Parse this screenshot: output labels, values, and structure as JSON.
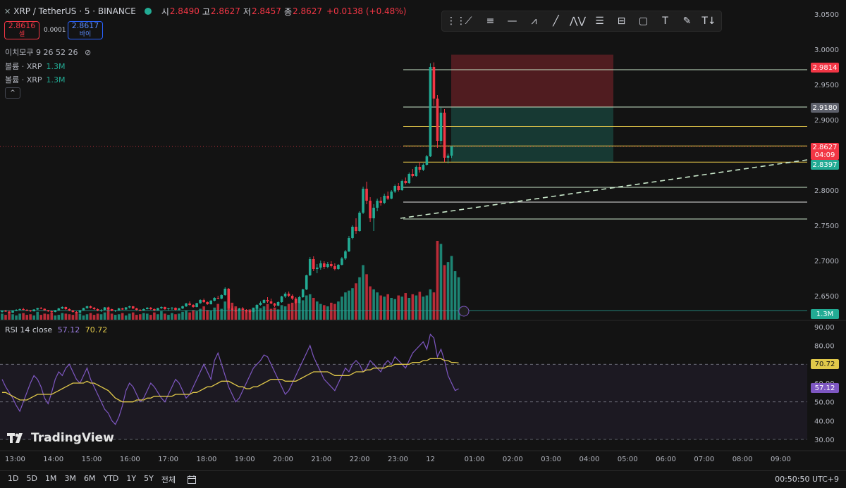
{
  "header": {
    "symbol": "XRP / TetherUS · 5 · BINANCE",
    "open_label": "시",
    "open": "2.8490",
    "high_label": "고",
    "high": "2.8627",
    "low_label": "저",
    "low": "2.8457",
    "close_label": "종",
    "close": "2.8627",
    "change": "+0.0138 (+0.48%)"
  },
  "quote": {
    "sell_price": "2.8616",
    "sell_label": "셀",
    "spread": "0.0001",
    "buy_price": "2.8617",
    "buy_label": "바이"
  },
  "indicators": {
    "moving_avg": "이치모쿠 9 26 52 26",
    "volume_1_label": "볼륨 · XRP",
    "volume_1_value": "1.3M",
    "volume_2_label": "볼륨 · XRP",
    "volume_2_value": "1.3M",
    "collapse": "^"
  },
  "rsi": {
    "label": "RSI 14 close",
    "value": "57.12",
    "ma": "70.72"
  },
  "logo": "TradingView",
  "colors": {
    "up": "#22ab94",
    "down": "#f23645",
    "rsi": "#7e57c2",
    "rsi_ma": "#e0c84a",
    "bg": "#131313"
  },
  "toolbar_icons": [
    "grip-icon",
    "trend-icon",
    "fib-icon",
    "horizontal-line-icon",
    "pattern-icon",
    "line-icon",
    "abcd-icon",
    "parallel-icon",
    "channel-icon",
    "rectangle-icon",
    "text-icon",
    "brush-icon",
    "text-note-icon"
  ],
  "price_axis": {
    "ticks": [
      "3.0500",
      "3.0000",
      "2.9500",
      "2.9000",
      "2.8500",
      "2.8000",
      "2.7500",
      "2.7000",
      "2.6500"
    ],
    "labels": [
      {
        "text": "2.9814",
        "color": "#f23645"
      },
      {
        "text": "2.9180",
        "color": "#5d606b"
      },
      {
        "text": "2.8627",
        "sub": "04:09",
        "color": "#f23645"
      },
      {
        "text": "2.8397",
        "color": "#22ab94"
      },
      {
        "text": "1.3M",
        "color": "#22ab94"
      }
    ]
  },
  "rsi_axis": {
    "ticks": [
      "90.00",
      "80.00",
      "60.00",
      "50.00",
      "40.00",
      "30.00"
    ],
    "labels": [
      {
        "text": "70.72",
        "color": "#e0c84a"
      },
      {
        "text": "57.12",
        "color": "#7e57c2"
      }
    ]
  },
  "time_axis": [
    "13:00",
    "14:00",
    "15:00",
    "16:00",
    "17:00",
    "18:00",
    "19:00",
    "20:00",
    "21:00",
    "22:00",
    "23:00",
    "12",
    "01:00",
    "02:00",
    "03:00",
    "04:00",
    "05:00",
    "06:00",
    "07:00",
    "08:00",
    "09:00"
  ],
  "bottom_bar": {
    "ranges": [
      "1D",
      "5D",
      "1M",
      "3M",
      "6M",
      "YTD",
      "1Y",
      "5Y",
      "전체"
    ],
    "clock": "00:50:50 UTC+9"
  },
  "chart_data": {
    "type": "candlestick",
    "ylim": [
      2.62,
      3.07
    ],
    "drawn_levels": [
      2.9814,
      2.918,
      2.8905,
      2.8627,
      2.8397,
      2.804,
      2.783,
      2.759
    ],
    "position": {
      "stop": 2.9814,
      "entry": 2.918,
      "target": 2.8397
    },
    "candles": [
      [
        2.627,
        2.629,
        2.626,
        2.6285
      ],
      [
        2.6285,
        2.63,
        2.627,
        2.6275
      ],
      [
        2.6275,
        2.629,
        2.625,
        2.626
      ],
      [
        2.626,
        2.6295,
        2.6255,
        2.629
      ],
      [
        2.629,
        2.631,
        2.628,
        2.63
      ],
      [
        2.63,
        2.632,
        2.629,
        2.631
      ],
      [
        2.631,
        2.633,
        2.6295,
        2.63
      ],
      [
        2.63,
        2.631,
        2.628,
        2.629
      ],
      [
        2.629,
        2.63,
        2.627,
        2.628
      ],
      [
        2.628,
        2.631,
        2.6275,
        2.6305
      ],
      [
        2.6305,
        2.633,
        2.63,
        2.6325
      ],
      [
        2.6325,
        2.634,
        2.631,
        2.6315
      ],
      [
        2.6315,
        2.632,
        2.629,
        2.6295
      ],
      [
        2.6295,
        2.63,
        2.627,
        2.628
      ],
      [
        2.628,
        2.629,
        2.626,
        2.627
      ],
      [
        2.627,
        2.63,
        2.6265,
        2.6295
      ],
      [
        2.6295,
        2.633,
        2.629,
        2.632
      ],
      [
        2.632,
        2.635,
        2.631,
        2.634
      ],
      [
        2.634,
        2.6345,
        2.63,
        2.631
      ],
      [
        2.631,
        2.632,
        2.628,
        2.629
      ],
      [
        2.629,
        2.63,
        2.626,
        2.627
      ],
      [
        2.627,
        2.628,
        2.625,
        2.626
      ],
      [
        2.626,
        2.63,
        2.6255,
        2.6295
      ],
      [
        2.6295,
        2.633,
        2.629,
        2.6325
      ],
      [
        2.6325,
        2.636,
        2.6315,
        2.635
      ],
      [
        2.635,
        2.636,
        2.632,
        2.633
      ],
      [
        2.633,
        2.634,
        2.63,
        2.631
      ],
      [
        2.631,
        2.632,
        2.628,
        2.629
      ],
      [
        2.629,
        2.631,
        2.627,
        2.63
      ],
      [
        2.63,
        2.634,
        2.6295,
        2.6335
      ],
      [
        2.6335,
        2.6345,
        2.63,
        2.631
      ],
      [
        2.631,
        2.6315,
        2.628,
        2.6285
      ],
      [
        2.6285,
        2.63,
        2.627,
        2.6295
      ],
      [
        2.6295,
        2.633,
        2.629,
        2.632
      ],
      [
        2.632,
        2.633,
        2.63,
        2.6305
      ],
      [
        2.6305,
        2.634,
        2.63,
        2.6335
      ],
      [
        2.6335,
        2.636,
        2.632,
        2.635
      ],
      [
        2.635,
        2.6355,
        2.631,
        2.632
      ],
      [
        2.632,
        2.633,
        2.629,
        2.63
      ],
      [
        2.63,
        2.631,
        2.628,
        2.629
      ],
      [
        2.629,
        2.632,
        2.6285,
        2.631
      ],
      [
        2.631,
        2.634,
        2.6305,
        2.633
      ],
      [
        2.633,
        2.634,
        2.63,
        2.631
      ],
      [
        2.631,
        2.632,
        2.628,
        2.6295
      ],
      [
        2.6295,
        2.633,
        2.629,
        2.6325
      ],
      [
        2.6325,
        2.635,
        2.631,
        2.634
      ],
      [
        2.634,
        2.6345,
        2.63,
        2.631
      ],
      [
        2.631,
        2.633,
        2.629,
        2.632
      ],
      [
        2.632,
        2.634,
        2.63,
        2.633
      ],
      [
        2.633,
        2.6335,
        2.629,
        2.63
      ],
      [
        2.63,
        2.633,
        2.629,
        2.632
      ],
      [
        2.632,
        2.636,
        2.631,
        2.635
      ],
      [
        2.635,
        2.64,
        2.634,
        2.639
      ],
      [
        2.639,
        2.642,
        2.636,
        2.637
      ],
      [
        2.637,
        2.638,
        2.633,
        2.634
      ],
      [
        2.634,
        2.64,
        2.6335,
        2.6395
      ],
      [
        2.6395,
        2.645,
        2.6385,
        2.644
      ],
      [
        2.644,
        2.646,
        2.64,
        2.641
      ],
      [
        2.641,
        2.642,
        2.637,
        2.638
      ],
      [
        2.638,
        2.644,
        2.6375,
        2.643
      ],
      [
        2.643,
        2.648,
        2.642,
        2.647
      ],
      [
        2.647,
        2.65,
        2.645,
        2.646
      ],
      [
        2.646,
        2.652,
        2.645,
        2.651
      ],
      [
        2.651,
        2.662,
        2.65,
        2.66
      ],
      [
        2.66,
        2.661,
        2.63,
        2.632
      ],
      [
        2.632,
        2.635,
        2.628,
        2.63
      ],
      [
        2.63,
        2.632,
        2.627,
        2.629
      ],
      [
        2.629,
        2.633,
        2.6285,
        2.632
      ],
      [
        2.632,
        2.634,
        2.629,
        2.63
      ],
      [
        2.63,
        2.631,
        2.626,
        2.628
      ],
      [
        2.628,
        2.63,
        2.625,
        2.627
      ],
      [
        2.627,
        2.633,
        2.6265,
        2.632
      ],
      [
        2.632,
        2.638,
        2.631,
        2.637
      ],
      [
        2.637,
        2.642,
        2.636,
        2.64
      ],
      [
        2.64,
        2.645,
        2.639,
        2.644
      ],
      [
        2.644,
        2.648,
        2.64,
        2.642
      ],
      [
        2.642,
        2.646,
        2.638,
        2.639
      ],
      [
        2.639,
        2.64,
        2.634,
        2.636
      ],
      [
        2.636,
        2.642,
        2.635,
        2.641
      ],
      [
        2.641,
        2.65,
        2.64,
        2.649
      ],
      [
        2.649,
        2.655,
        2.647,
        2.653
      ],
      [
        2.653,
        2.656,
        2.648,
        2.65
      ],
      [
        2.65,
        2.652,
        2.644,
        2.646
      ],
      [
        2.646,
        2.648,
        2.638,
        2.64
      ],
      [
        2.64,
        2.65,
        2.639,
        2.648
      ],
      [
        2.648,
        2.66,
        2.647,
        2.659
      ],
      [
        2.659,
        2.68,
        2.658,
        2.679
      ],
      [
        2.679,
        2.705,
        2.678,
        2.702
      ],
      [
        2.702,
        2.706,
        2.685,
        2.688
      ],
      [
        2.688,
        2.695,
        2.682,
        2.69
      ],
      [
        2.69,
        2.7,
        2.687,
        2.696
      ],
      [
        2.696,
        2.699,
        2.688,
        2.691
      ],
      [
        2.691,
        2.698,
        2.689,
        2.695
      ],
      [
        2.695,
        2.699,
        2.69,
        2.692
      ],
      [
        2.692,
        2.696,
        2.686,
        2.688
      ],
      [
        2.688,
        2.695,
        2.687,
        2.694
      ],
      [
        2.694,
        2.705,
        2.693,
        2.703
      ],
      [
        2.703,
        2.715,
        2.701,
        2.713
      ],
      [
        2.713,
        2.735,
        2.712,
        2.732
      ],
      [
        2.732,
        2.75,
        2.73,
        2.748
      ],
      [
        2.748,
        2.76,
        2.738,
        2.742
      ],
      [
        2.742,
        2.77,
        2.741,
        2.768
      ],
      [
        2.768,
        2.805,
        2.766,
        2.802
      ],
      [
        2.802,
        2.812,
        2.78,
        2.785
      ],
      [
        2.785,
        2.79,
        2.755,
        2.76
      ],
      [
        2.76,
        2.78,
        2.742,
        2.775
      ],
      [
        2.775,
        2.788,
        2.77,
        2.785
      ],
      [
        2.785,
        2.79,
        2.778,
        2.782
      ],
      [
        2.782,
        2.795,
        2.78,
        2.792
      ],
      [
        2.792,
        2.798,
        2.786,
        2.788
      ],
      [
        2.788,
        2.8,
        2.787,
        2.798
      ],
      [
        2.798,
        2.808,
        2.796,
        2.806
      ],
      [
        2.806,
        2.81,
        2.798,
        2.8
      ],
      [
        2.8,
        2.815,
        2.799,
        2.813
      ],
      [
        2.813,
        2.818,
        2.808,
        2.81
      ],
      [
        2.81,
        2.825,
        2.809,
        2.823
      ],
      [
        2.823,
        2.83,
        2.818,
        2.82
      ],
      [
        2.82,
        2.835,
        2.819,
        2.833
      ],
      [
        2.833,
        2.84,
        2.825,
        2.829
      ],
      [
        2.829,
        2.838,
        2.827,
        2.836
      ],
      [
        2.836,
        2.85,
        2.835,
        2.848
      ],
      [
        2.848,
        2.98,
        2.847,
        2.975
      ],
      [
        2.975,
        2.9814,
        2.92,
        2.93
      ],
      [
        2.93,
        2.935,
        2.86,
        2.87
      ],
      [
        2.87,
        2.918,
        2.865,
        2.91
      ],
      [
        2.91,
        2.915,
        2.84,
        2.846
      ],
      [
        2.846,
        2.852,
        2.838,
        2.849
      ],
      [
        2.849,
        2.8627,
        2.8457,
        2.8627
      ]
    ],
    "volume": [
      0.1,
      0.08,
      0.12,
      0.09,
      0.07,
      0.1,
      0.11,
      0.08,
      0.09,
      0.07,
      0.13,
      0.08,
      0.1,
      0.09,
      0.12,
      0.07,
      0.08,
      0.11,
      0.1,
      0.09,
      0.08,
      0.12,
      0.1,
      0.07,
      0.09,
      0.11,
      0.08,
      0.1,
      0.09,
      0.12,
      0.18,
      0.1,
      0.08,
      0.09,
      0.11,
      0.07,
      0.1,
      0.12,
      0.08,
      0.09,
      0.11,
      0.1,
      0.08,
      0.12,
      0.09,
      0.14,
      0.1,
      0.08,
      0.11,
      0.09,
      0.1,
      0.13,
      0.15,
      0.12,
      0.16,
      0.14,
      0.18,
      0.22,
      0.16,
      0.15,
      0.2,
      0.26,
      0.18,
      0.3,
      0.35,
      0.28,
      0.22,
      0.18,
      0.16,
      0.14,
      0.17,
      0.2,
      0.24,
      0.19,
      0.22,
      0.26,
      0.18,
      0.2,
      0.17,
      0.24,
      0.22,
      0.26,
      0.28,
      0.3,
      0.34,
      0.32,
      0.4,
      0.42,
      0.36,
      0.3,
      0.26,
      0.24,
      0.22,
      0.28,
      0.26,
      0.3,
      0.38,
      0.45,
      0.48,
      0.52,
      0.6,
      0.7,
      0.9,
      0.75,
      0.55,
      0.5,
      0.45,
      0.4,
      0.38,
      0.42,
      0.36,
      0.34,
      0.4,
      0.38,
      0.44,
      0.36,
      0.42,
      0.4,
      0.46,
      0.38,
      0.4,
      0.5,
      0.45,
      1.3,
      1.25,
      0.9,
      0.95,
      1.05,
      0.8,
      0.7
    ],
    "rsi": [
      62,
      58,
      55,
      52,
      48,
      45,
      50,
      55,
      60,
      64,
      62,
      58,
      52,
      49,
      55,
      62,
      66,
      64,
      68,
      70,
      66,
      62,
      60,
      64,
      68,
      62,
      58,
      54,
      50,
      46,
      44,
      40,
      38,
      42,
      48,
      56,
      60,
      58,
      54,
      50,
      52,
      56,
      60,
      58,
      55,
      52,
      50,
      54,
      58,
      62,
      60,
      56,
      52,
      54,
      58,
      62,
      66,
      70,
      66,
      62,
      72,
      76,
      70,
      64,
      58,
      54,
      50,
      52,
      56,
      60,
      64,
      68,
      70,
      72,
      75,
      74,
      70,
      66,
      62,
      58,
      54,
      56,
      60,
      64,
      68,
      72,
      76,
      80,
      74,
      70,
      66,
      62,
      60,
      58,
      56,
      60,
      64,
      68,
      66,
      70,
      72,
      70,
      66,
      68,
      72,
      70,
      68,
      66,
      70,
      72,
      70,
      74,
      72,
      70,
      68,
      72,
      76,
      78,
      80,
      82,
      78,
      86,
      84,
      74,
      78,
      72,
      64,
      60,
      56,
      57
    ],
    "rsi_ma": [
      55,
      55,
      54,
      53,
      52,
      51,
      51,
      51,
      52,
      53,
      54,
      54,
      54,
      54,
      54,
      55,
      56,
      57,
      58,
      59,
      60,
      60,
      60,
      60,
      61,
      60,
      60,
      59,
      58,
      57,
      56,
      54,
      52,
      51,
      50,
      50,
      50,
      50,
      51,
      51,
      51,
      52,
      52,
      53,
      53,
      53,
      53,
      53,
      53,
      54,
      54,
      54,
      54,
      54,
      55,
      55,
      56,
      57,
      58,
      58,
      59,
      60,
      61,
      61,
      61,
      60,
      59,
      58,
      58,
      57,
      57,
      58,
      58,
      59,
      60,
      61,
      62,
      62,
      62,
      62,
      61,
      61,
      61,
      61,
      62,
      63,
      64,
      65,
      66,
      66,
      66,
      66,
      66,
      65,
      64,
      64,
      64,
      64,
      64,
      65,
      66,
      66,
      66,
      67,
      67,
      68,
      68,
      68,
      68,
      69,
      69,
      70,
      70,
      70,
      70,
      70,
      71,
      71,
      71,
      72,
      72,
      73,
      73,
      73,
      73,
      72,
      72,
      71,
      71,
      70.72
    ]
  }
}
